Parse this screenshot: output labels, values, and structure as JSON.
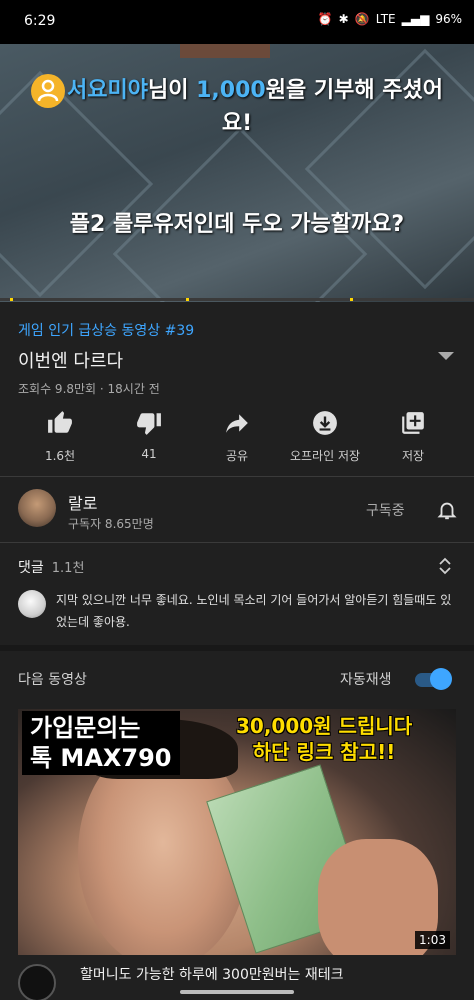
{
  "status": {
    "time": "6:29",
    "network": "LTE",
    "battery": "96%"
  },
  "player": {
    "donor": "서요미야",
    "donor_suffix": "님이 ",
    "amount": "1,000",
    "donation_text": "원을 기부해 주셨어",
    "donation_text2": "요!",
    "message": "플2 룰루유저인데 두오 가능할까요?"
  },
  "video": {
    "hashtag": "게임 인기 급상승 동영상 #39",
    "title": "이번엔 다르다",
    "meta": "조회수 9.8만회 · 18시간 전"
  },
  "actions": [
    {
      "label": "1.6천",
      "icon": "thumbs-up-icon"
    },
    {
      "label": "41",
      "icon": "thumbs-down-icon"
    },
    {
      "label": "공유",
      "icon": "share-icon"
    },
    {
      "label": "오프라인 저장",
      "icon": "download-icon"
    },
    {
      "label": "저장",
      "icon": "add-to-playlist-icon"
    }
  ],
  "channel": {
    "name": "랄로",
    "subscribers": "구독자 8.65만명",
    "subscribed_label": "구독중"
  },
  "comments": {
    "label": "댓글",
    "count": "1.1천",
    "top_comment": "지막 있으니깐 너무 좋네요. 노인네 목소리 기어 들어가서 알아듣기 힘들때도 있었는데 좋아용."
  },
  "up_next": {
    "label": "다음 동영상",
    "autoplay_label": "자동재생",
    "autoplay_on": true
  },
  "next_video": {
    "overlay_left_line1": "가입문의는",
    "overlay_left_line2": "톡 MAX790",
    "overlay_right_line1": "30,000원 드립니다",
    "overlay_right_line2": "하단 링크 참고!!",
    "duration": "1:03",
    "title": "할머니도 가능한 하루에 300만원버는 재테크"
  },
  "colors": {
    "accent": "#3ea6ff",
    "background": "#202020"
  }
}
